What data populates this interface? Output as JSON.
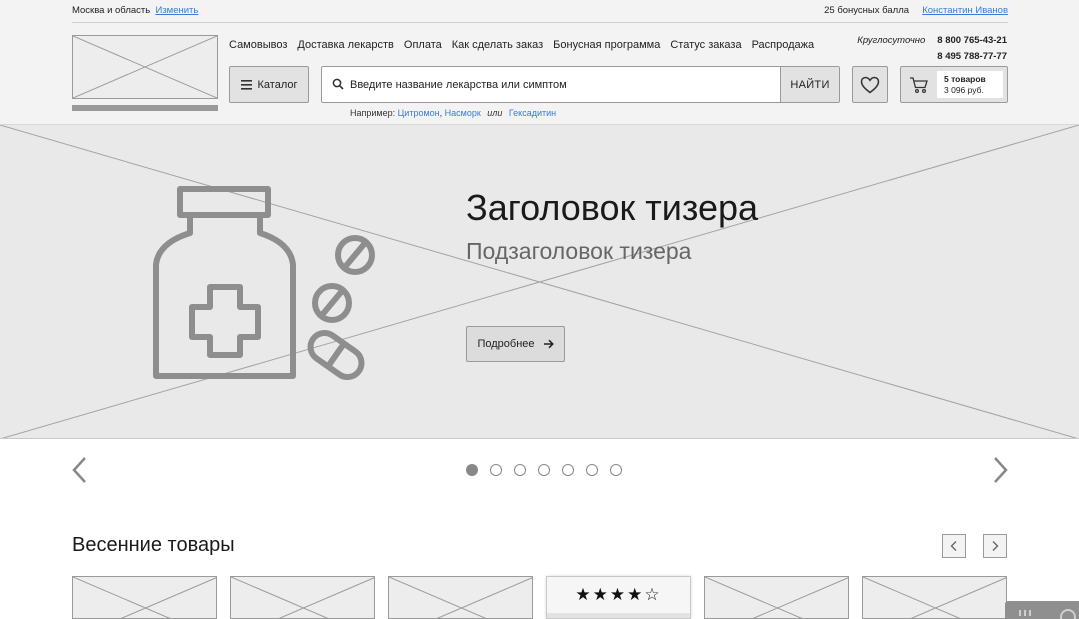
{
  "topline": {
    "region": "Москва и область",
    "change_link": "Изменить",
    "bonus": "25 бонусных балла",
    "user_link": "Константин Иванов"
  },
  "nav": {
    "items": [
      "Самовывоз",
      "Доставка лекарств",
      "Оплата",
      "Как сделать заказ",
      "Бонусная программа",
      "Статус заказа",
      "Распродажа"
    ]
  },
  "contacts": {
    "hours": "Круглосуточно",
    "phone1": "8 800 765-43-21",
    "phone2": "8 495 788-77-77"
  },
  "catalog": {
    "label": "Каталог",
    "icon": "menu-icon"
  },
  "search": {
    "placeholder": "Введите название лекарства или симптом",
    "button": "НАЙТИ",
    "icon": "search-icon",
    "hint_prefix": "Например:",
    "hint_ex1": "Цитромон",
    "hint_ex2": "Насморк",
    "hint_or": "или",
    "hint_ex3": "Гексадитин"
  },
  "favorites": {
    "icon": "heart-icon"
  },
  "cart": {
    "icon": "cart-icon",
    "count": "5 товаров",
    "total": "3 096 руб."
  },
  "hero": {
    "title": "Заголовок тизера",
    "subtitle": "Подзаголовок тизера",
    "button": "Подробнее",
    "slides_count": 7,
    "active_slide": 1
  },
  "section": {
    "title": "Весенние товары"
  },
  "products": {
    "rated_card_index": 4,
    "rating": "★★★★☆",
    "rating_value": 4,
    "rating_max": 5
  },
  "colors": {
    "link": "#3a7bd5",
    "placeholder_bg": "#e9e9e9",
    "border": "#9a9a9a"
  }
}
